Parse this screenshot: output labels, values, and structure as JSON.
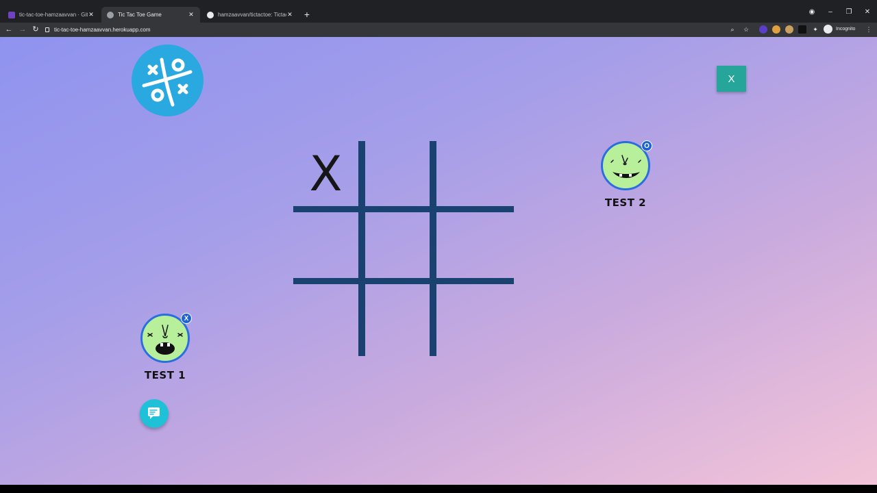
{
  "browser": {
    "tabs": [
      {
        "title": "tic-tac-toe-hamzaavvan · GitHub",
        "active": false,
        "favicon_color": "#6f42c1"
      },
      {
        "title": "Tic Tac Toe Game",
        "active": true,
        "favicon_color": "#9aa0a6"
      },
      {
        "title": "hamzaavvan/tictactoe: Tictactoe",
        "active": false,
        "favicon_color": "#e8eaed"
      }
    ],
    "url": "tic-tac-toe-hamzaavvan.herokuapp.com",
    "incognito_label": "Incognito"
  },
  "game": {
    "turn_button_label": "X",
    "board": [
      "X",
      "",
      "",
      "",
      "",
      "",
      "",
      "",
      ""
    ],
    "line_color": "#1a4270"
  },
  "players": [
    {
      "name": "TEST 1",
      "symbol": "X"
    },
    {
      "name": "TEST 2",
      "symbol": "O"
    }
  ],
  "colors": {
    "accent": "#26a69a",
    "logo": "#2aa8e0",
    "chat_button": "#1ec1d8",
    "avatar_bg": "#b8ef9b",
    "badge": "#1e63d6"
  }
}
